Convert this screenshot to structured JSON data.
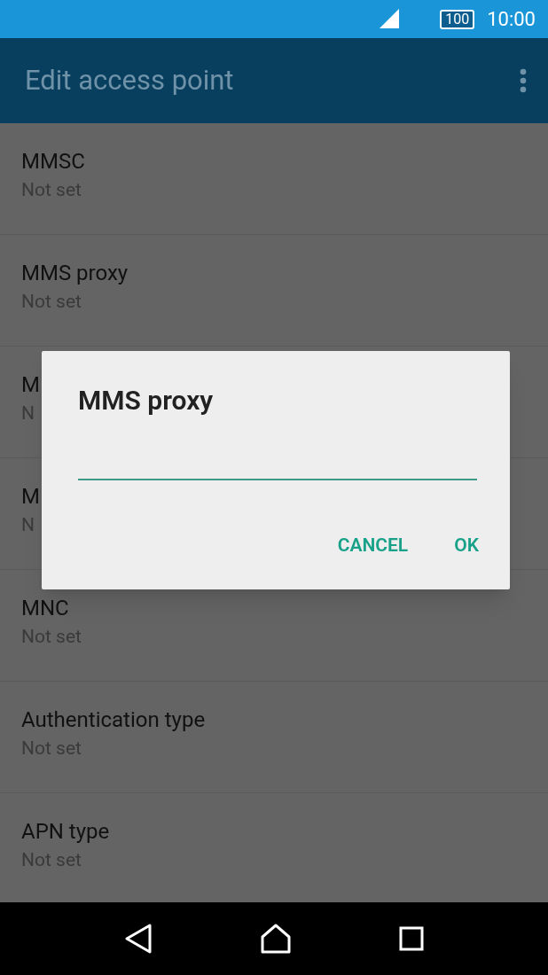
{
  "status_bar": {
    "battery": "100",
    "time": "10:00"
  },
  "app_bar": {
    "title": "Edit access point"
  },
  "settings": [
    {
      "title": "MMSC",
      "value": "Not set"
    },
    {
      "title": "MMS proxy",
      "value": "Not set"
    },
    {
      "title": "M",
      "value": "N"
    },
    {
      "title": "M",
      "value": "N"
    },
    {
      "title": "MNC",
      "value": "Not set"
    },
    {
      "title": "Authentication type",
      "value": "Not set"
    },
    {
      "title": "APN type",
      "value": "Not set"
    }
  ],
  "dialog": {
    "title": "MMS proxy",
    "buttons": [
      "CANCEL",
      "OK"
    ]
  }
}
